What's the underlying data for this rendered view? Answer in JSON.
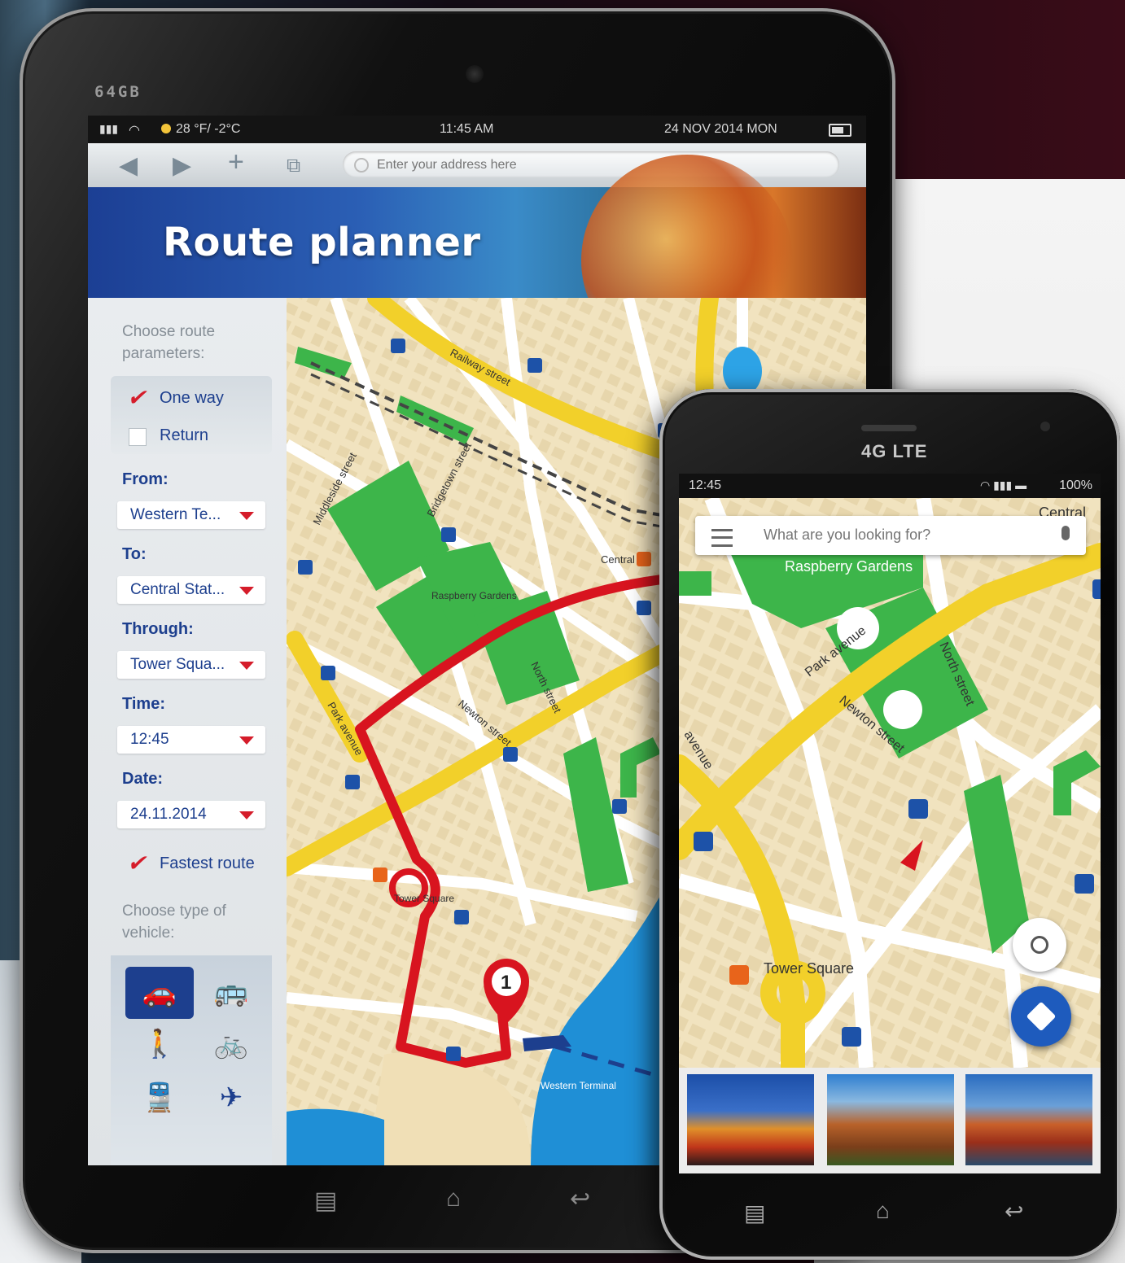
{
  "tablet": {
    "brand": "64GB",
    "status": {
      "weather": "28 °F/ -2°C",
      "time": "11:45 AM",
      "date": "24 NOV 2014 MON"
    },
    "browser": {
      "address_placeholder": "Enter your address here",
      "back_icon": "back-arrow-icon",
      "forward_icon": "forward-arrow-icon",
      "new_tab_icon": "plus-icon",
      "tabs_icon": "tabs-icon"
    },
    "banner_title": "Route planner",
    "form": {
      "heading": "Choose route parameters:",
      "one_way": "One way",
      "return": "Return",
      "from_label": "From:",
      "from_value": "Western Te...",
      "to_label": "To:",
      "to_value": "Central Stat...",
      "through_label": "Through:",
      "through_value": "Tower Squa...",
      "time_label": "Time:",
      "time_value": "12:45",
      "date_label": "Date:",
      "date_value": "24.11.2014",
      "fastest": "Fastest route",
      "vehicle_heading": "Choose type of vehicle:",
      "one_way_checked": true,
      "return_checked": false,
      "fastest_checked": true
    },
    "vehicles": [
      {
        "name": "car",
        "glyph": "🚗",
        "active": true
      },
      {
        "name": "bus",
        "glyph": "🚌",
        "active": false
      },
      {
        "name": "walk",
        "glyph": "🚶",
        "active": false
      },
      {
        "name": "bike",
        "glyph": "🚲",
        "active": false
      },
      {
        "name": "train",
        "glyph": "🚆",
        "active": false
      },
      {
        "name": "plane",
        "glyph": "✈",
        "active": false
      }
    ],
    "map": {
      "streets": [
        "Railway street",
        "Middleside street",
        "Bridgetown street",
        "North street",
        "Newton street",
        "Park avenue"
      ],
      "places": [
        "Raspberry Gardens",
        "Central",
        "Tower Square",
        "Western Terminal"
      ],
      "marker": "1"
    },
    "colors": {
      "route": "#d8141f",
      "road": "#f2d02a",
      "park": "#3db54a",
      "water": "#1f8fd6",
      "brand_blue": "#1d3f8e"
    }
  },
  "phone": {
    "brand": "4G LTE",
    "status": {
      "time": "12:45",
      "battery": "100%"
    },
    "search_placeholder": "What are you looking for?",
    "map": {
      "top_label": "Central",
      "park": "Raspberry Gardens",
      "streets": [
        "Park avenue",
        "North street",
        "Newton street",
        "avenue"
      ],
      "square": "Tower Square"
    }
  }
}
